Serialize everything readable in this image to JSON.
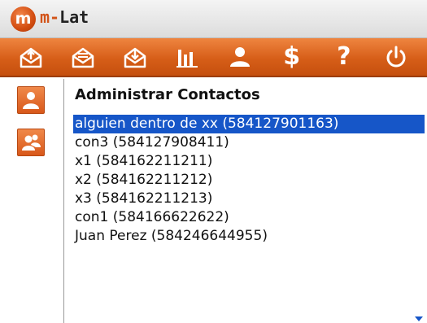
{
  "app": {
    "logo_letter": "m",
    "name_prefix": "m-",
    "name_rest": "Lat",
    "accent_color": "#d65e18"
  },
  "toolbar": {
    "buttons": [
      {
        "icon": "mail-send-icon"
      },
      {
        "icon": "mail-open-icon"
      },
      {
        "icon": "mail-download-icon"
      },
      {
        "icon": "bar-chart-icon"
      },
      {
        "icon": "person-icon"
      },
      {
        "icon": "dollar-icon",
        "glyph": "$"
      },
      {
        "icon": "help-icon",
        "glyph": "?"
      },
      {
        "icon": "power-icon"
      }
    ]
  },
  "sidebar": {
    "buttons": [
      {
        "icon": "single-contact-icon"
      },
      {
        "icon": "group-contacts-icon"
      }
    ]
  },
  "main": {
    "title": "Administrar Contactos",
    "contacts": [
      {
        "label": "alguien dentro de xx (584127901163)",
        "selected": true
      },
      {
        "label": "con3 (584127908411)",
        "selected": false
      },
      {
        "label": "x1 (584162211211)",
        "selected": false
      },
      {
        "label": "x2 (584162211212)",
        "selected": false
      },
      {
        "label": "x3 (584162211213)",
        "selected": false
      },
      {
        "label": "con1 (584166622622)",
        "selected": false
      },
      {
        "label": "Juan Perez (584246644955)",
        "selected": false
      }
    ]
  }
}
